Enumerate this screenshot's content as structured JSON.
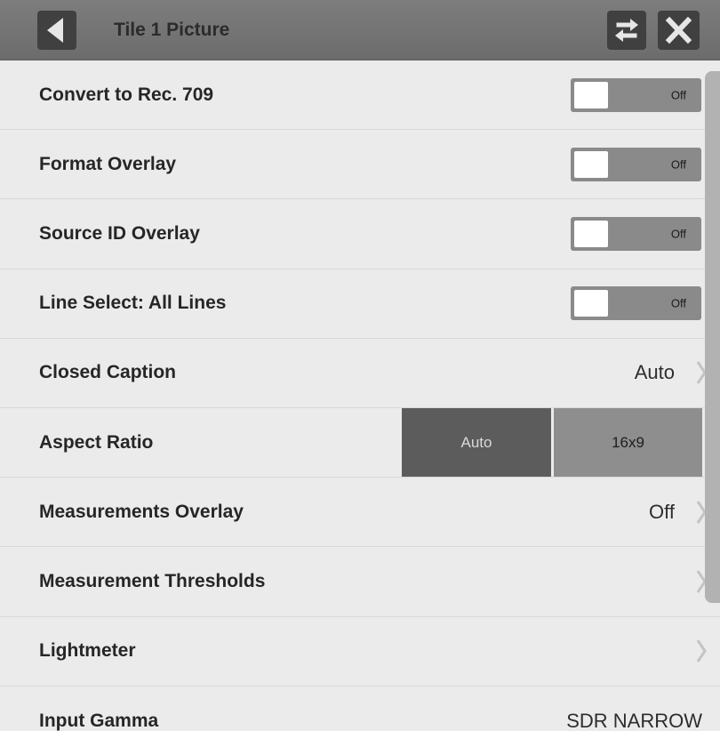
{
  "header": {
    "title": "Tile 1 Picture",
    "back_icon": "back-arrow-icon",
    "swap_icon": "swap-arrows-icon",
    "close_icon": "close-x-icon"
  },
  "rows": [
    {
      "label": "Convert to Rec. 709",
      "type": "toggle",
      "state": "Off"
    },
    {
      "label": "Format Overlay",
      "type": "toggle",
      "state": "Off"
    },
    {
      "label": "Source ID Overlay",
      "type": "toggle",
      "state": "Off"
    },
    {
      "label": "Line Select: All Lines",
      "type": "toggle",
      "state": "Off"
    },
    {
      "label": "Closed Caption",
      "type": "submenu",
      "value": "Auto"
    },
    {
      "label": "Aspect Ratio",
      "type": "segmented",
      "options": [
        "Auto",
        "16x9"
      ],
      "selected": "Auto"
    },
    {
      "label": "Measurements Overlay",
      "type": "submenu",
      "value": "Off"
    },
    {
      "label": "Measurement Thresholds",
      "type": "submenu",
      "value": ""
    },
    {
      "label": "Lightmeter",
      "type": "submenu",
      "value": ""
    },
    {
      "label": "Input Gamma",
      "type": "value",
      "value": "SDR NARROW"
    }
  ],
  "colors": {
    "header_bg": "#737373",
    "panel_bg": "#ebebeb",
    "toggle_off": "#8a8a8a",
    "segment_selected": "#5c5c5c",
    "segment_unselected": "#8e8e8e"
  }
}
